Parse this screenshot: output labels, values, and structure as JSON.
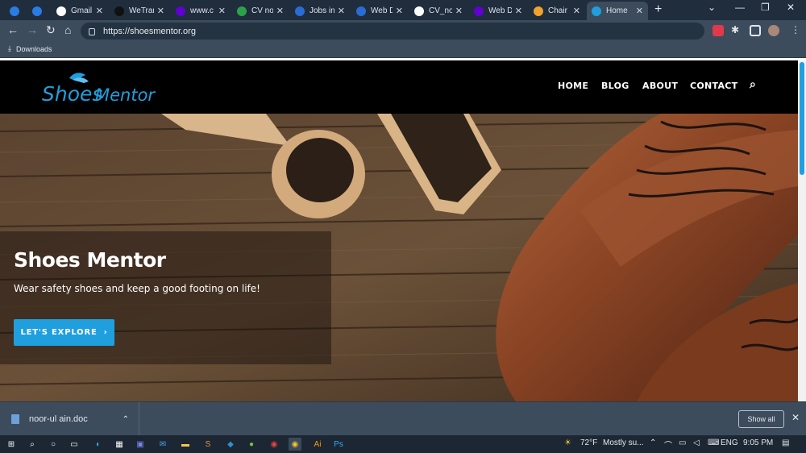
{
  "browser": {
    "tabs": [
      {
        "title": "",
        "icon": "app-icon",
        "color": "#2a7be4"
      },
      {
        "title": "",
        "icon": "app-icon",
        "color": "#2a7be4"
      },
      {
        "title": "Gmail",
        "icon": "google-icon",
        "color": "#ffffff"
      },
      {
        "title": "WeTrar",
        "icon": "wetransfer-icon",
        "color": "#111111"
      },
      {
        "title": "www.c",
        "icon": "yahoo-icon",
        "color": "#6001d2"
      },
      {
        "title": "CV no",
        "icon": "leaf-icon",
        "color": "#2da14a"
      },
      {
        "title": "Jobs in",
        "icon": "rozee-icon",
        "color": "#2b6cd4"
      },
      {
        "title": "Web D",
        "icon": "rozee-icon",
        "color": "#2b6cd4"
      },
      {
        "title": "CV_no",
        "icon": "globe-icon",
        "color": "#ffffff"
      },
      {
        "title": "Web D",
        "icon": "yahoo-icon",
        "color": "#6001d2"
      },
      {
        "title": "Chair F",
        "icon": "chair-icon",
        "color": "#f0a32a"
      },
      {
        "title": "Home",
        "icon": "site-icon",
        "color": "#1f9fde",
        "active": true
      }
    ],
    "address": "https://shoesmentor.org",
    "bookmark_label": "Downloads"
  },
  "site": {
    "logo_text": "ShoesMentor",
    "logo_part1": "Shoes",
    "logo_part2": "Mentor",
    "nav": [
      "HOME",
      "BLOG",
      "ABOUT",
      "CONTACT"
    ],
    "hero_title": "Shoes Mentor",
    "hero_subtitle": "Wear safety shoes and keep a good footing on life!",
    "cta_label": "LET'S EXPLORE",
    "accent_color": "#1f9fde"
  },
  "download_bar": {
    "filename": "noor-ul ain.doc",
    "show_all_label": "Show all"
  },
  "taskbar": {
    "weather": "72°F",
    "weather_desc": "Mostly su...",
    "language": "ENG",
    "time": "9:05 PM"
  }
}
